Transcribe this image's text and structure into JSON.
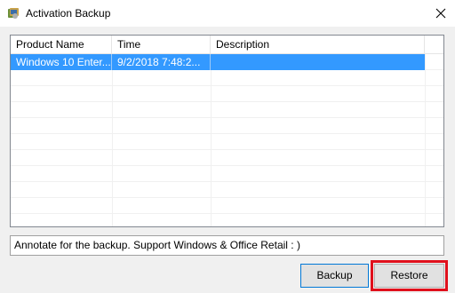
{
  "window": {
    "title": "Activation Backup",
    "app_icon": "app-icon",
    "close_icon": "close-icon"
  },
  "list": {
    "columns": [
      "Product Name",
      "Time",
      "Description"
    ],
    "rows": [
      {
        "product": "Windows 10 Enter...",
        "time": "9/2/2018 7:48:2...",
        "description": ""
      }
    ]
  },
  "annotation": {
    "value": "Annotate for the backup. Support Windows & Office Retail  : )"
  },
  "buttons": {
    "backup": "Backup",
    "restore": "Restore"
  },
  "colors": {
    "selection": "#3399ff",
    "highlight": "#e0101c"
  }
}
